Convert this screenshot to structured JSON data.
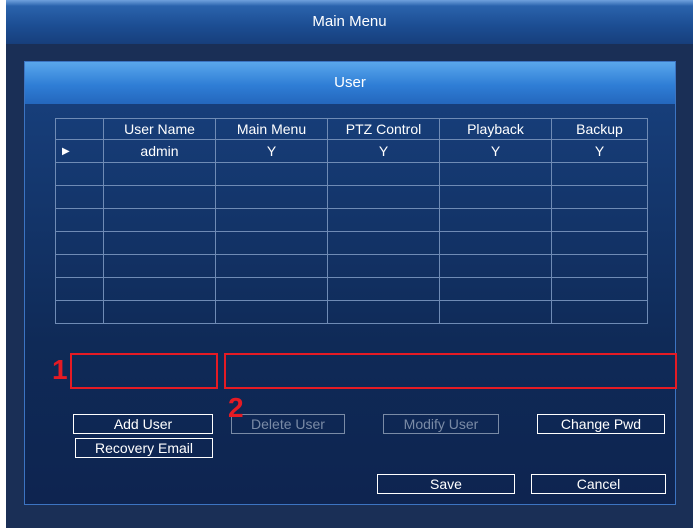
{
  "window": {
    "title": "Main Menu"
  },
  "dialog": {
    "title": "User"
  },
  "table": {
    "columns": [
      "",
      "User Name",
      "Main Menu",
      "PTZ Control",
      "Playback",
      "Backup"
    ],
    "rows": [
      [
        "▶",
        "admin",
        "Y",
        "Y",
        "Y",
        "Y"
      ],
      [
        "",
        "",
        "",
        "",
        "",
        ""
      ],
      [
        "",
        "",
        "",
        "",
        "",
        ""
      ],
      [
        "",
        "",
        "",
        "",
        "",
        ""
      ],
      [
        "",
        "",
        "",
        "",
        "",
        ""
      ],
      [
        "",
        "",
        "",
        "",
        "",
        ""
      ],
      [
        "",
        "",
        "",
        "",
        "",
        ""
      ],
      [
        "",
        "",
        "",
        "",
        "",
        ""
      ]
    ]
  },
  "buttons": {
    "add_user": "Add User",
    "delete_user": "Delete User",
    "modify_user": "Modify User",
    "change_pwd": "Change Pwd",
    "recovery_email": "Recovery Email",
    "save": "Save",
    "cancel": "Cancel"
  },
  "annotations": {
    "marker_1": "1",
    "marker_2": "2"
  },
  "colors": {
    "accent": "#2f7ed6",
    "background": "#10284e",
    "highlight": "#e51b24",
    "disabled_text": "#7a8ba6"
  }
}
